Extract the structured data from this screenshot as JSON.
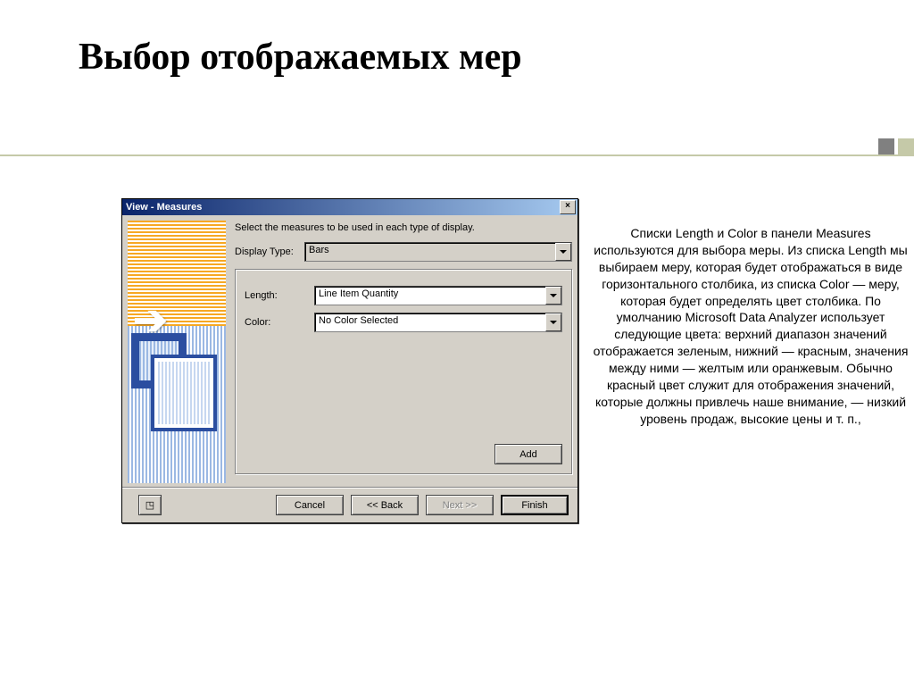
{
  "slide": {
    "title": "Выбор отображаемых мер",
    "side_text": "Списки Length и Color в панели Measures используются для выбора меры. Из списка Length мы выбираем меру, которая будет отображаться в виде горизонтального столбика, из списка Color — меру, которая будет определять цвет столбика.\nПо умолчанию Microsoft Data Analyzer использует следующие цвета: верхний диапазон значений отображается зеленым, нижний — красным, значения между ними — желтым или оранжевым. Обычно красный цвет служит для отображения значений, которые должны привлечь наше внимание, — низкий уровень продаж, высокие цены и т. п.,"
  },
  "dialog": {
    "title": "View - Measures",
    "instruction": "Select the measures to be used in each type of display.",
    "labels": {
      "display_type": "Display Type:",
      "length": "Length:",
      "color": "Color:"
    },
    "values": {
      "display_type": "Bars",
      "length": "Line Item Quantity",
      "color": "No Color Selected"
    },
    "buttons": {
      "add": "Add",
      "cancel": "Cancel",
      "back": "<< Back",
      "next": "Next >>",
      "finish": "Finish",
      "help": "?"
    }
  }
}
